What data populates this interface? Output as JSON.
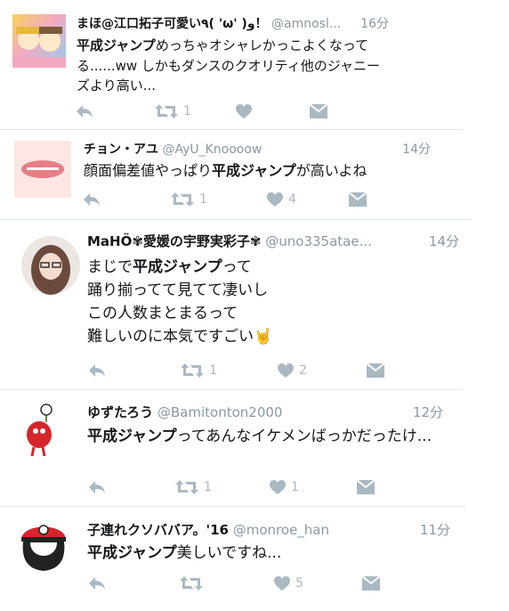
{
  "tweets": [
    {
      "name": "まほ@江口拓子可愛い٩( 'ω' )و！",
      "handle": "@amnosl...",
      "time": "16分",
      "body_hl": "平成ジャンプ",
      "body_rest": "めっちゃオシャレかっこよくなってる......ww しかもダンスのクオリティ他のジャニーズより高い...",
      "retweets": "1",
      "likes": ""
    },
    {
      "name": "チョン・アユ",
      "handle": "@AyU_Knoooow",
      "time": "14分",
      "body_pre": "顔面偏差値やっぱり",
      "body_hl": "平成ジャンプ",
      "body_rest": "が高いよね",
      "retweets": "1",
      "likes": "4"
    },
    {
      "name": "MaHÖ✾愛媛の宇野実彩子✾",
      "handle": "@uno335atae...",
      "time": "14分",
      "line1_pre": "まじで",
      "body_hl": "平成ジャンプ",
      "line1_post": "って",
      "line2": "踊り揃ってて見てて凄いし",
      "line3": "この人数まとまるって",
      "line4": "難しいのに本気ですごい🤘",
      "retweets": "1",
      "likes": "2"
    },
    {
      "name": "ゆずたろう",
      "handle": "@Bamitonton2000",
      "time": "12分",
      "body_hl": "平成ジャンプ",
      "body_rest": "ってあんなイケメンばっかだったけ...",
      "retweets": "1",
      "likes": "1"
    },
    {
      "name": "子連れクソババア。'16",
      "handle": "@monroe_han",
      "time": "11分",
      "body_hl": "平成ジャンプ",
      "body_rest": "美しいですね...",
      "retweets": "",
      "likes": "5"
    }
  ],
  "colors": {
    "icon": "#aab8c2",
    "handle": "#8899a6",
    "text": "#14171a",
    "divider": "#e1e8ed"
  },
  "icons": [
    "reply-icon",
    "retweet-icon",
    "like-icon",
    "dm-icon"
  ]
}
